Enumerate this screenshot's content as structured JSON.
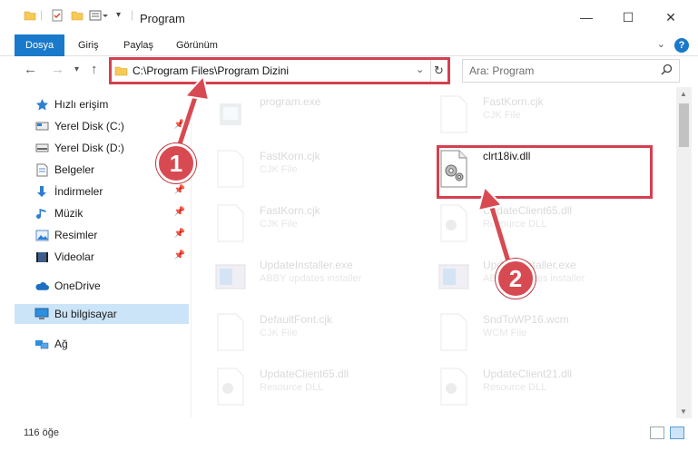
{
  "window": {
    "title": "Program",
    "minimize": "—",
    "maximize": "☐",
    "close": "✕"
  },
  "ribbon": {
    "tabs": [
      {
        "label": "Dosya"
      },
      {
        "label": "Giriş"
      },
      {
        "label": "Paylaş"
      },
      {
        "label": "Görünüm"
      }
    ],
    "help": "?",
    "toggle": "⌄"
  },
  "address": {
    "path": "C:\\Program Files\\Program Dizini",
    "search_placeholder": "Ara: Program"
  },
  "sidebar": {
    "items": [
      {
        "label": "Hızlı erişim",
        "icon": "star-icon"
      },
      {
        "label": "Yerel Disk (C:)",
        "icon": "drive-icon"
      },
      {
        "label": "Yerel Disk (D:)",
        "icon": "drive-icon"
      },
      {
        "label": "Belgeler",
        "icon": "document-icon"
      },
      {
        "label": "İndirmeler",
        "icon": "download-icon"
      },
      {
        "label": "Müzik",
        "icon": "music-icon"
      },
      {
        "label": "Resimler",
        "icon": "pictures-icon"
      },
      {
        "label": "Videolar",
        "icon": "video-icon"
      },
      {
        "label": "OneDrive",
        "icon": "cloud-icon"
      },
      {
        "label": "Bu bilgisayar",
        "icon": "computer-icon"
      },
      {
        "label": "Ağ",
        "icon": "network-icon"
      }
    ]
  },
  "files": [
    {
      "name": "program.exe",
      "sub": "",
      "type": "exe"
    },
    {
      "name": "FastKorn.cjk",
      "sub": "CJK File",
      "type": "doc"
    },
    {
      "name": "FastKorn.cjk",
      "sub": "CJK File",
      "type": "doc"
    },
    {
      "name": "clrt18iv.dll",
      "sub": "",
      "type": "dll"
    },
    {
      "name": "FastKorn.cjk",
      "sub": "CJK File",
      "type": "doc"
    },
    {
      "name": "UpdateClient65.dll",
      "sub": "Resource DLL",
      "type": "dll"
    },
    {
      "name": "UpdateInstaller.exe",
      "sub": "ABBY updates installer",
      "type": "app"
    },
    {
      "name": "UpdateInstaller.exe",
      "sub": "ABBY updates installer",
      "type": "app"
    },
    {
      "name": "DefaultFont.cjk",
      "sub": "CJK File",
      "type": "doc"
    },
    {
      "name": "SndToWP16.wcm",
      "sub": "WCM File",
      "type": "doc"
    },
    {
      "name": "UpdateClient65.dll",
      "sub": "Resource DLL",
      "type": "dll"
    },
    {
      "name": "UpdateClient21.dll",
      "sub": "Resource DLL",
      "type": "dll"
    }
  ],
  "status": {
    "count": "116 öğe"
  },
  "callouts": {
    "one": "1",
    "two": "2"
  },
  "colors": {
    "accent": "#1979ca",
    "highlight": "#d5404f"
  }
}
